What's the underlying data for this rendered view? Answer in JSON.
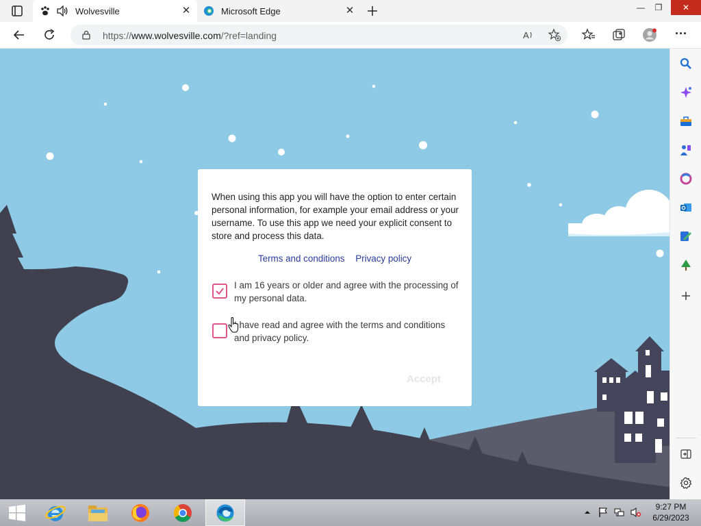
{
  "browser": {
    "tabs": [
      {
        "title": "Wolvesville",
        "close": "✕"
      },
      {
        "title": "Microsoft Edge",
        "close": "✕"
      }
    ],
    "new_tab": "+",
    "window_controls": {
      "minimize": "—",
      "restore": "❐",
      "close": "✕"
    },
    "url_prefix": "https://",
    "url_domain": "www.wolvesville.com",
    "url_path": "/?ref=landing",
    "more": "···"
  },
  "dialog": {
    "intro": "When using this app you will have the option to enter certain personal information, for example your email address or your username. To use this app we need your explicit consent to store and process this data.",
    "links": {
      "terms": "Terms and conditions",
      "privacy": "Privacy policy"
    },
    "consent_age": {
      "label": "I am 16 years or older and agree with the processing of my personal data.",
      "checked": true
    },
    "consent_terms": {
      "label": "I have read and agree with the terms and conditions and privacy policy.",
      "checked": false
    },
    "accept_label": "Accept"
  },
  "colors": {
    "sky": "#8ecae6",
    "ground": "#40404f",
    "accent_pink": "#e1538a",
    "link": "#283b9a"
  },
  "sidebar": {
    "icons": [
      "search-icon",
      "copilot-icon",
      "shopping-icon",
      "games-icon",
      "office-icon",
      "outlook-icon",
      "drop-icon",
      "tree-icon",
      "add-icon",
      "hide-sidebar-icon",
      "settings-icon"
    ]
  },
  "taskbar": {
    "apps": [
      "internet-explorer-icon",
      "file-explorer-icon",
      "firefox-icon",
      "chrome-icon",
      "edge-icon"
    ],
    "time": "9:27 PM",
    "date": "6/29/2023"
  }
}
